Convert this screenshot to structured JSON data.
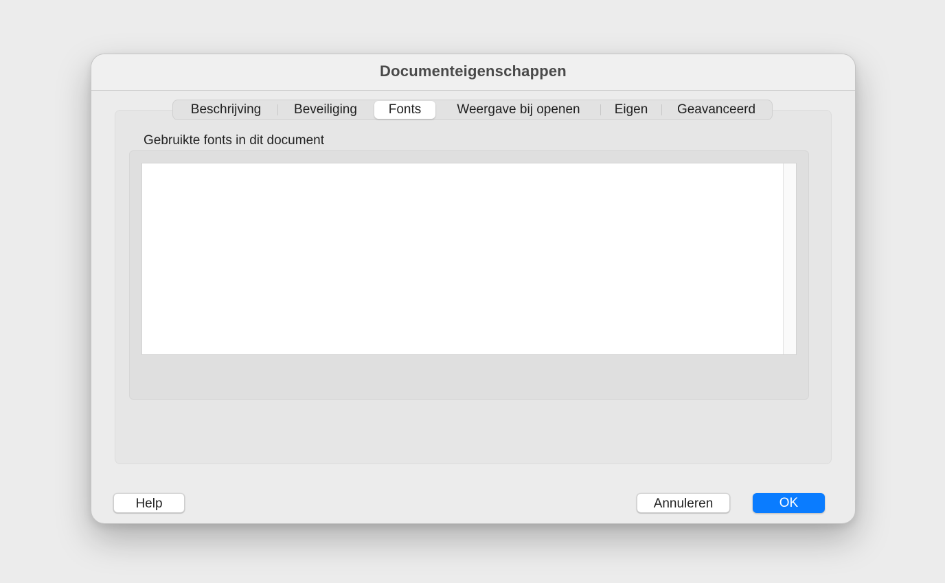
{
  "window": {
    "title": "Documenteigenschappen"
  },
  "tabs": [
    {
      "label": "Beschrijving",
      "active": false
    },
    {
      "label": "Beveiliging",
      "active": false
    },
    {
      "label": "Fonts",
      "active": true
    },
    {
      "label": "Weergave bij openen",
      "active": false
    },
    {
      "label": "Eigen",
      "active": false
    },
    {
      "label": "Geavanceerd",
      "active": false
    }
  ],
  "fonts_panel": {
    "group_label": "Gebruikte fonts in dit document",
    "fonts": []
  },
  "buttons": {
    "help": "Help",
    "cancel": "Annuleren",
    "ok": "OK"
  },
  "colors": {
    "accent": "#0a7cff"
  }
}
